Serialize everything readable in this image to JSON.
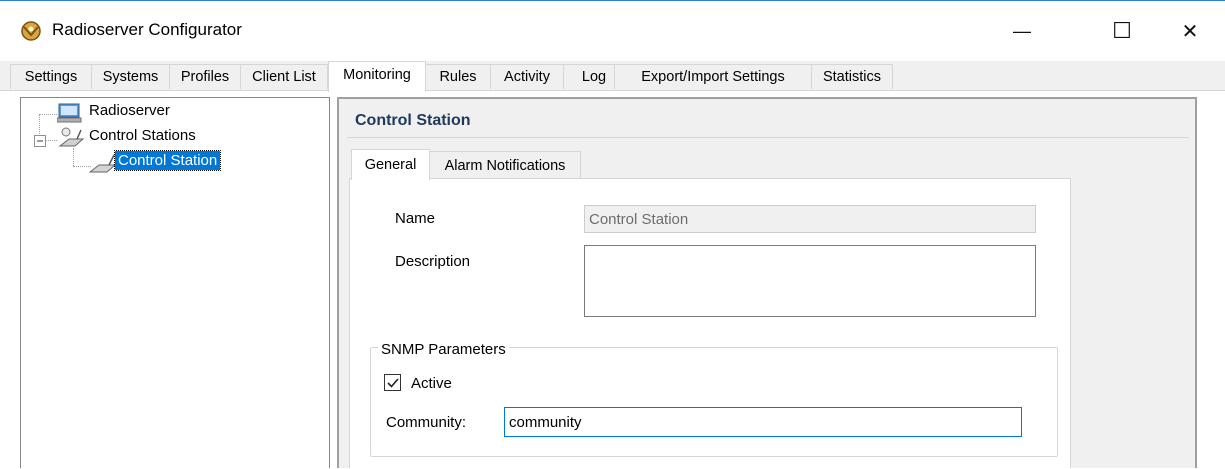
{
  "window": {
    "title": "Radioserver Configurator",
    "controls": {
      "minimize": "—",
      "maximize": "☐",
      "close": "✕"
    }
  },
  "tabs": [
    {
      "label": "Settings"
    },
    {
      "label": "Systems"
    },
    {
      "label": "Profiles"
    },
    {
      "label": "Client List"
    },
    {
      "label": "Monitoring",
      "active": true
    },
    {
      "label": "Rules"
    },
    {
      "label": "Activity"
    },
    {
      "label": "Log"
    },
    {
      "label": "Export/Import Settings"
    },
    {
      "label": "Statistics"
    }
  ],
  "tree": {
    "root": {
      "label": "Radioserver",
      "icon": "server-icon"
    },
    "group": {
      "label": "Control Stations",
      "icon": "control-stations-icon",
      "expander": "⊟"
    },
    "child": {
      "label": "Control Station",
      "icon": "radio-icon",
      "selected": true
    }
  },
  "panel": {
    "heading": "Control Station",
    "inner_tabs": [
      {
        "label": "General",
        "active": true
      },
      {
        "label": "Alarm Notifications"
      }
    ],
    "general": {
      "name_label": "Name",
      "name_value": "Control Station",
      "description_label": "Description",
      "description_value": "",
      "snmp": {
        "legend": "SNMP Parameters",
        "active_label": "Active",
        "active_checked": true,
        "community_label": "Community:",
        "community_value": "community"
      }
    }
  },
  "colors": {
    "accent": "#0078d7",
    "heading": "#1e395b",
    "window_bg": "#f0f0f0"
  }
}
